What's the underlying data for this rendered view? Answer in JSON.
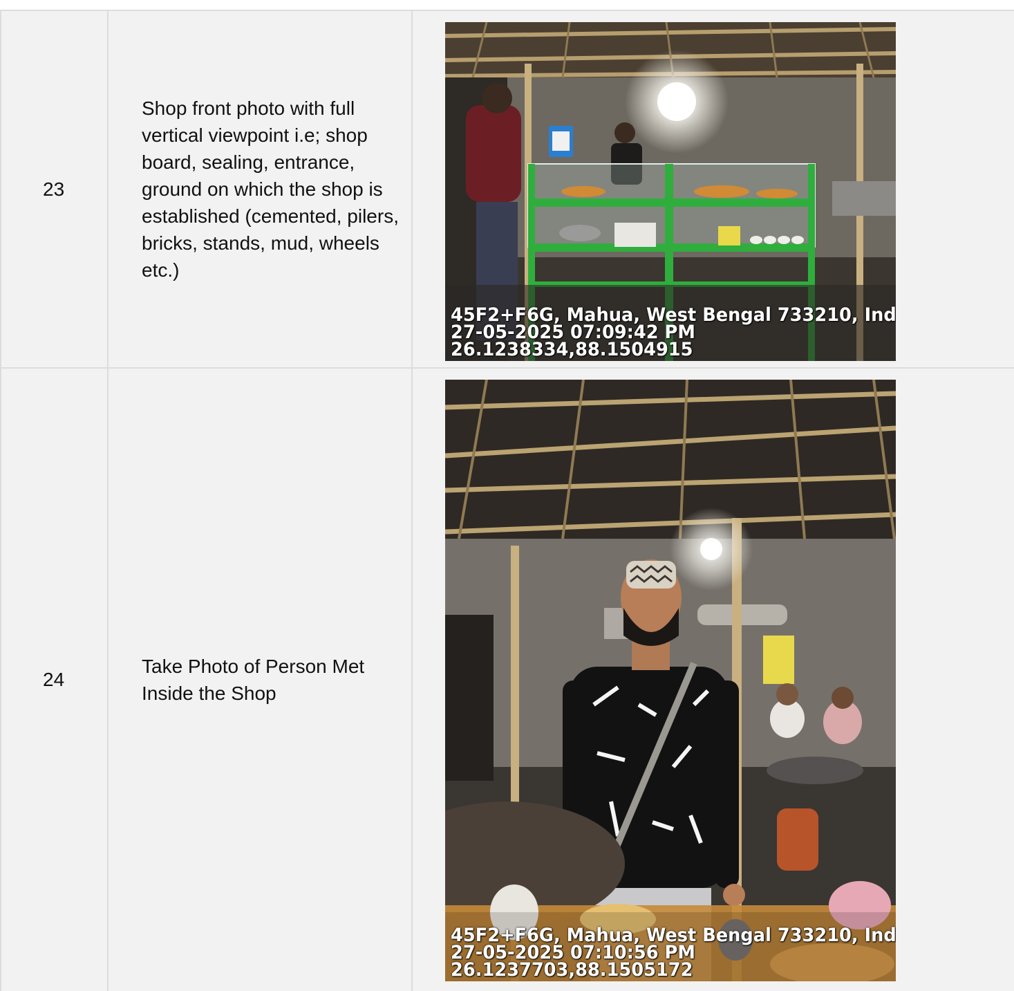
{
  "rows": [
    {
      "number": "23",
      "description": "Shop front photo with full vertical viewpoint i.e; shop board, sealing, entrance, ground on which the shop is established (cemented, pilers, bricks, stands, mud, wheels etc.)",
      "photo": {
        "address": "45F2+F6G, Mahua, West Bengal 733210, Ind",
        "datetime": "27-05-2025 07:09:42 PM",
        "coordinates": "26.1238334,88.1504915"
      }
    },
    {
      "number": "24",
      "description": "Take Photo of Person Met Inside the Shop",
      "photo": {
        "address": "45F2+F6G, Mahua, West Bengal 733210, Ind",
        "datetime": "27-05-2025 07:10:56 PM",
        "coordinates": "26.1237703,88.1505172"
      }
    }
  ]
}
